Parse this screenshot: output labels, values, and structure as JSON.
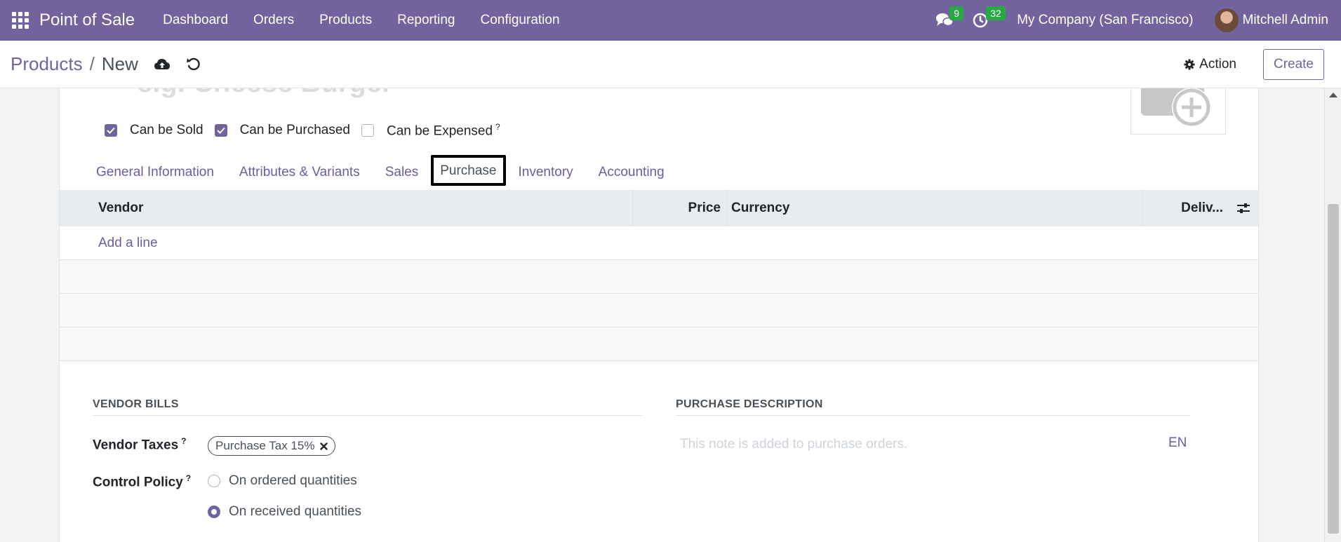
{
  "navbar": {
    "app_name": "Point of Sale",
    "menu": [
      "Dashboard",
      "Orders",
      "Products",
      "Reporting",
      "Configuration"
    ],
    "messages_count": "9",
    "activities_count": "32",
    "company": "My Company (San Francisco)",
    "user": "Mitchell Admin",
    "icons": [
      "apps-grid-icon",
      "chat-icon",
      "clock-icon"
    ]
  },
  "control_panel": {
    "breadcrumb_parent": "Products",
    "breadcrumb_sep": "/",
    "breadcrumb_current": "New",
    "action_label": "Action",
    "create_label": "Create",
    "icons": [
      "cloud-upload-icon",
      "undo-icon",
      "gear-icon"
    ]
  },
  "form": {
    "name_placeholder": "e.g. Cheese Burger",
    "checkboxes": [
      {
        "label": "Can be Sold",
        "checked": true
      },
      {
        "label": "Can be Purchased",
        "checked": true
      },
      {
        "label": "Can be Expensed",
        "checked": false,
        "help": "?"
      }
    ],
    "tabs": [
      "General Information",
      "Attributes & Variants",
      "Sales",
      "Purchase",
      "Inventory",
      "Accounting"
    ],
    "active_tab": "Purchase",
    "vendor_table": {
      "columns": [
        "Vendor",
        "Price",
        "Currency",
        "Deliv..."
      ],
      "add_line": "Add a line"
    },
    "vendor_bills": {
      "title": "VENDOR BILLS",
      "vendor_taxes_label": "Vendor Taxes",
      "vendor_taxes_help": "?",
      "tax_tag": "Purchase Tax 15%",
      "control_policy_label": "Control Policy",
      "control_policy_help": "?",
      "options": [
        {
          "label": "On ordered quantities",
          "selected": false
        },
        {
          "label": "On received quantities",
          "selected": true
        }
      ]
    },
    "purchase_description": {
      "title": "PURCHASE DESCRIPTION",
      "placeholder": "This note is added to purchase orders.",
      "lang": "EN"
    }
  },
  "colors": {
    "brand": "#71639e",
    "badge": "#28a745",
    "link": "#6c5ca0"
  }
}
